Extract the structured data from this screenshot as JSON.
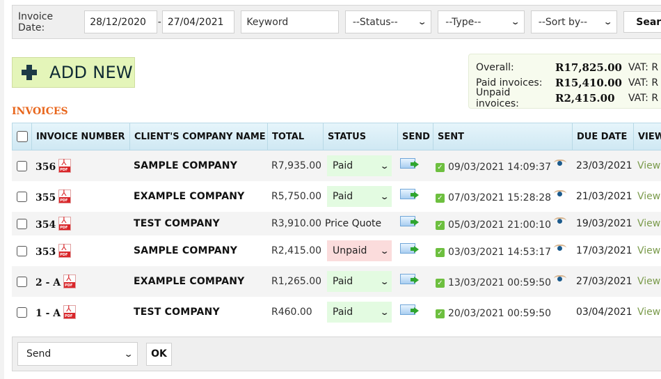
{
  "filters": {
    "invoice_date_label": "Invoice Date:",
    "date_from": "28/12/2020",
    "date_separator": "-",
    "date_to": "27/04/2021",
    "keyword_placeholder": "Keyword",
    "status_select": "--Status--",
    "type_select": "--Type--",
    "sort_select": "--Sort by--",
    "search_button": "Search"
  },
  "add_new_label": "ADD NEW",
  "summary": {
    "rows": [
      {
        "label": "Overall:",
        "value": "R17,825.00",
        "vat": "VAT: R"
      },
      {
        "label": "Paid invoices:",
        "value": "R15,410.00",
        "vat": "VAT: R"
      },
      {
        "label": "Unpaid invoices:",
        "value": "R2,415.00",
        "vat": "VAT: R"
      }
    ]
  },
  "section_title": "INVOICES",
  "table": {
    "columns": [
      "INVOICE NUMBER",
      "CLIENT'S COMPANY NAME",
      "TOTAL",
      "STATUS",
      "SEND",
      "SENT",
      "DUE DATE",
      "VIEW"
    ],
    "rows": [
      {
        "number": "356",
        "company": "SAMPLE COMPANY",
        "total": "R7,935.00",
        "status": "Paid",
        "status_type": "select-paid",
        "sent": "09/03/2021 14:09:37",
        "viewed": true,
        "due": "23/03/2021",
        "view": "View"
      },
      {
        "number": "355",
        "company": "EXAMPLE COMPANY",
        "total": "R5,750.00",
        "status": "Paid",
        "status_type": "select-paid",
        "sent": "07/03/2021 15:28:28",
        "viewed": true,
        "due": "21/03/2021",
        "view": "View"
      },
      {
        "number": "354",
        "company": "TEST COMPANY",
        "total": "R3,910.00",
        "status": "Price Quote",
        "status_type": "text",
        "sent": "05/03/2021 21:00:10",
        "viewed": true,
        "due": "19/03/2021",
        "view": "View"
      },
      {
        "number": "353",
        "company": "SAMPLE COMPANY",
        "total": "R2,415.00",
        "status": "Unpaid",
        "status_type": "select-unpaid",
        "sent": "03/03/2021 14:53:17",
        "viewed": true,
        "due": "17/03/2021",
        "view": "View"
      },
      {
        "number": "2 - A",
        "company": "EXAMPLE COMPANY",
        "total": "R1,265.00",
        "status": "Paid",
        "status_type": "select-paid",
        "sent": "13/03/2021 00:59:50",
        "viewed": true,
        "due": "27/03/2021",
        "view": "View"
      },
      {
        "number": "1 - A",
        "company": "TEST COMPANY",
        "total": "R460.00",
        "status": "Paid",
        "status_type": "select-paid",
        "sent": "20/03/2021 00:59:50",
        "viewed": false,
        "due": "03/04/2021",
        "view": "View"
      }
    ]
  },
  "bulk": {
    "action_select": "Send",
    "ok_button": "OK"
  },
  "icons": {
    "chevron": "chevron-down-icon",
    "plus": "plus-icon",
    "pdf": "pdf-icon",
    "send": "send-email-icon",
    "check": "check-icon",
    "eye": "eye-icon"
  },
  "colors": {
    "section_title": "#e8661c",
    "add_new_bg": "#e4f5b9",
    "paid_bg": "#e3fbe1",
    "unpaid_bg": "#fbdcdc",
    "view_link": "#7b9b4c",
    "header_bg": "#d9eef7"
  }
}
